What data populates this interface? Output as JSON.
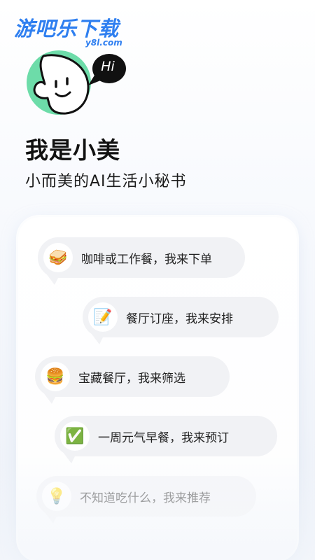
{
  "watermark": {
    "brand": "游吧乐下载",
    "domain": "y8l.com"
  },
  "avatar": {
    "greeting": "Hi",
    "accent_color": "#6ddca9"
  },
  "header": {
    "title": "我是小美",
    "subtitle": "小而美的AI生活小秘书"
  },
  "features": [
    {
      "icon": "sandwich-icon",
      "emoji": "🥪",
      "text": "咖啡或工作餐，我来下单"
    },
    {
      "icon": "memo-icon",
      "emoji": "📝",
      "text": "餐厅订座，我来安排"
    },
    {
      "icon": "burger-icon",
      "emoji": "🍔",
      "text": "宝藏餐厅，我来筛选"
    },
    {
      "icon": "check-mark-icon",
      "emoji": "✅",
      "text": "一周元气早餐，我来预订"
    },
    {
      "icon": "lightbulb-icon",
      "emoji": "💡",
      "text": "不知道吃什么，我来推荐"
    }
  ]
}
